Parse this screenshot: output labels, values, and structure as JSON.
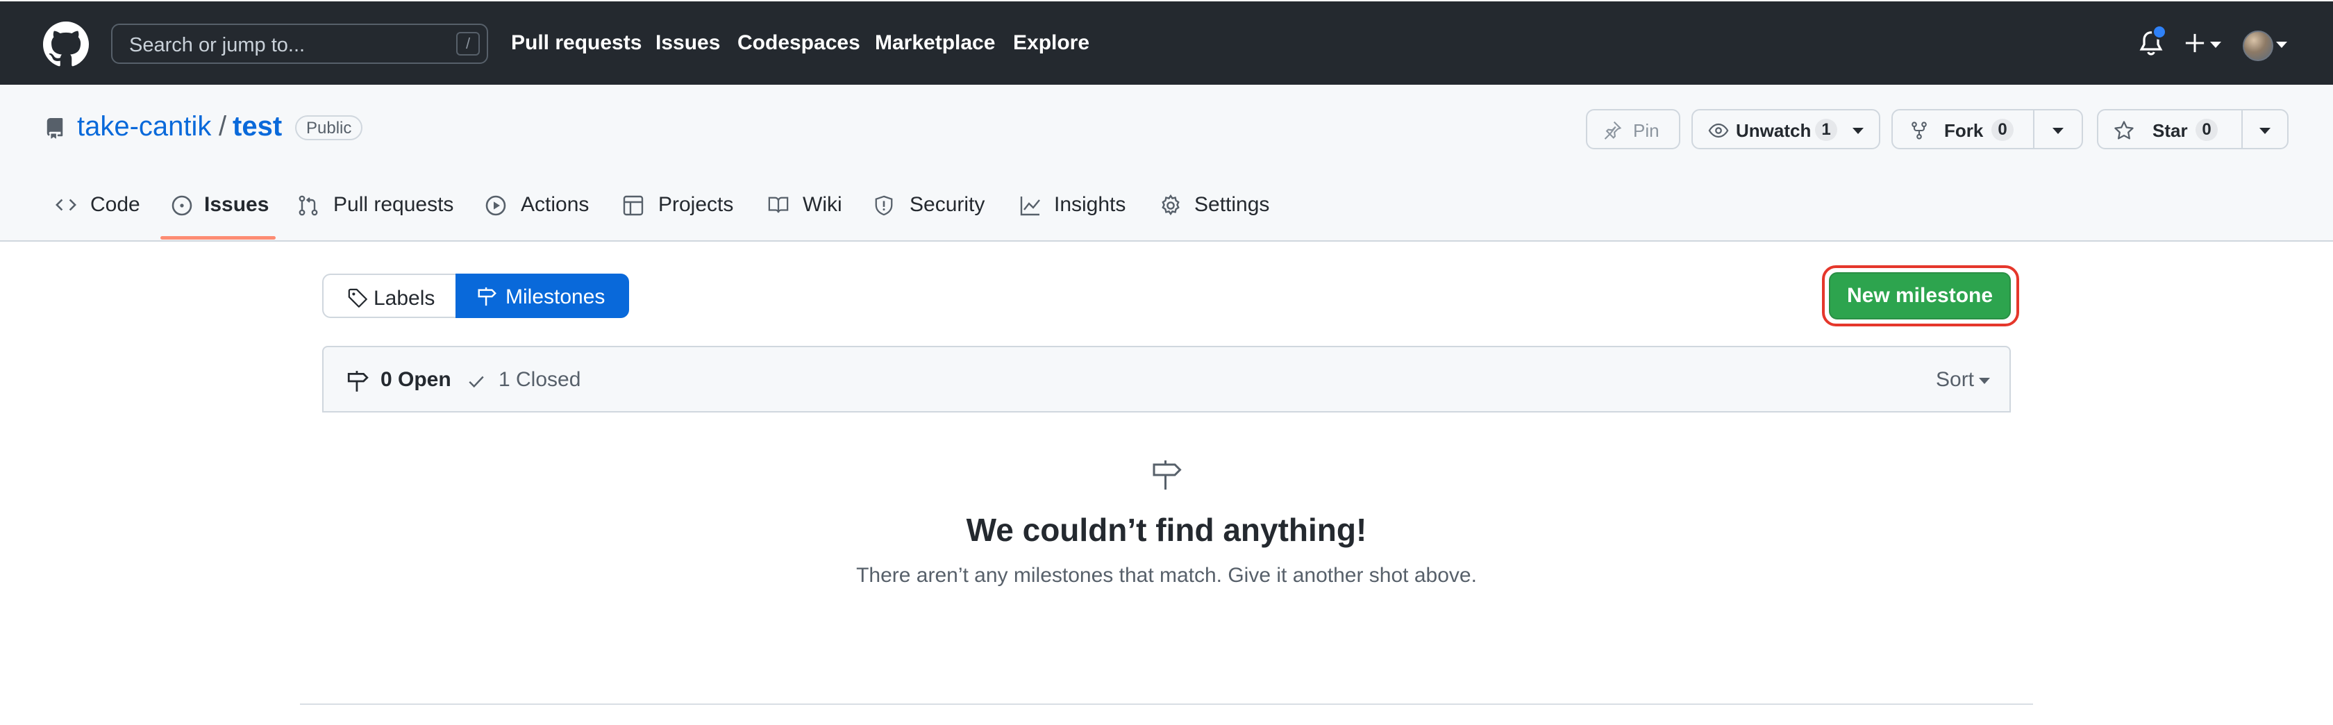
{
  "header": {
    "search_placeholder": "Search or jump to...",
    "search_shortcut": "/",
    "nav": [
      "Pull requests",
      "Issues",
      "Codespaces",
      "Marketplace",
      "Explore"
    ],
    "notification_dot_color": "#2f81f7"
  },
  "repo": {
    "owner": "take-cantik",
    "separator": "/",
    "name": "test",
    "visibility": "Public",
    "pin_label": "Pin",
    "unwatch_label": "Unwatch",
    "watch_count": "1",
    "fork_label": "Fork",
    "fork_count": "0",
    "star_label": "Star",
    "star_count": "0"
  },
  "tabs": [
    {
      "label": "Code",
      "icon": "code-icon"
    },
    {
      "label": "Issues",
      "icon": "issue-opened-icon",
      "selected": true
    },
    {
      "label": "Pull requests",
      "icon": "git-pull-request-icon"
    },
    {
      "label": "Actions",
      "icon": "play-icon"
    },
    {
      "label": "Projects",
      "icon": "table-icon"
    },
    {
      "label": "Wiki",
      "icon": "book-icon"
    },
    {
      "label": "Security",
      "icon": "shield-icon"
    },
    {
      "label": "Insights",
      "icon": "graph-icon"
    },
    {
      "label": "Settings",
      "icon": "gear-icon"
    }
  ],
  "subnav": {
    "labels": "Labels",
    "milestones": "Milestones",
    "new_milestone": "New milestone"
  },
  "list": {
    "open": "0 Open",
    "closed": "1 Closed",
    "sort": "Sort"
  },
  "blankslate": {
    "title": "We couldn’t find anything!",
    "subtitle": "There aren’t any milestones that match. Give it another shot above."
  },
  "colors": {
    "header_bg": "#24292f",
    "link": "#0969da",
    "primary_button": "#2da44e",
    "selected_tab_underline": "#fd8c73",
    "highlight_outline": "#e5372b"
  }
}
